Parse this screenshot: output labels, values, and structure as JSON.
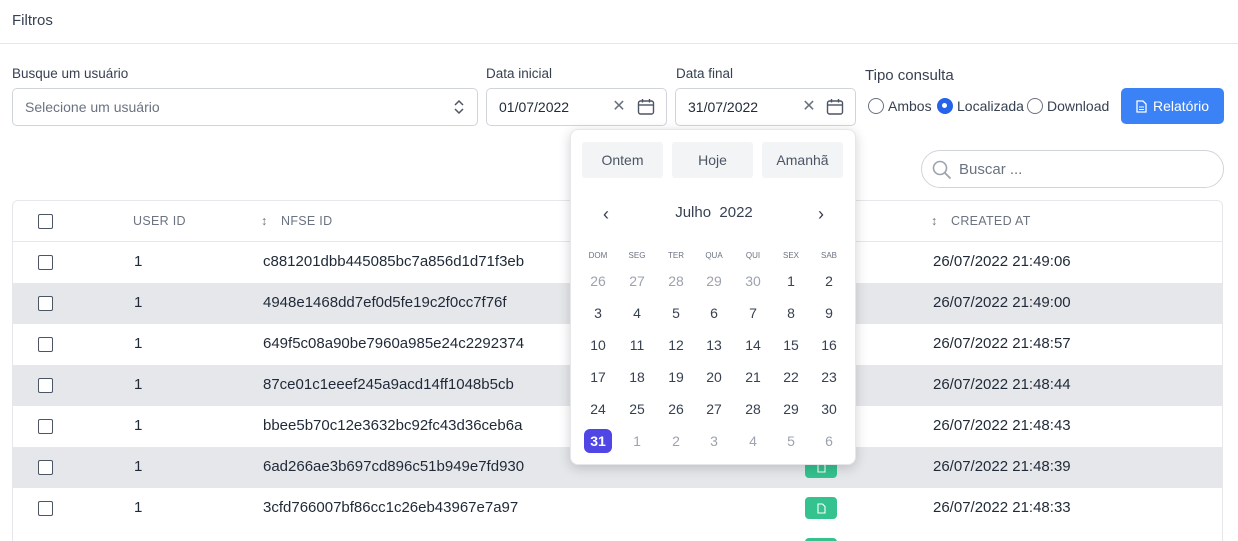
{
  "header": {
    "title": "Filtros"
  },
  "filters": {
    "user_label": "Busque um usuário",
    "user_placeholder": "Selecione um usuário",
    "start_label": "Data inicial",
    "start_value": "01/07/2022",
    "end_label": "Data final",
    "end_value": "31/07/2022",
    "type_label": "Tipo consulta",
    "types": [
      {
        "label": "Ambos",
        "checked": false
      },
      {
        "label": "Localizada",
        "checked": true
      },
      {
        "label": "Download",
        "checked": false
      }
    ],
    "report_button": "Relatório"
  },
  "search": {
    "placeholder": "Buscar ..."
  },
  "table": {
    "columns": [
      "USER ID",
      "NFSE ID",
      "CREATED AT"
    ],
    "rows": [
      {
        "user_id": "1",
        "nfse_id": "c881201dbb445085bc7a856d1d71f3eb",
        "created_at": "26/07/2022 21:49:06"
      },
      {
        "user_id": "1",
        "nfse_id": "4948e1468dd7ef0d5fe19c2f0cc7f76f",
        "created_at": "26/07/2022 21:49:00"
      },
      {
        "user_id": "1",
        "nfse_id": "649f5c08a90be7960a985e24c2292374",
        "created_at": "26/07/2022 21:48:57"
      },
      {
        "user_id": "1",
        "nfse_id": "87ce01c1eeef245a9acd14ff1048b5cb",
        "created_at": "26/07/2022 21:48:44"
      },
      {
        "user_id": "1",
        "nfse_id": "bbee5b70c12e3632bc92fc43d36ceb6a",
        "created_at": "26/07/2022 21:48:43"
      },
      {
        "user_id": "1",
        "nfse_id": "6ad266ae3b697cd896c51b949e7fd930",
        "created_at": "26/07/2022 21:48:39"
      },
      {
        "user_id": "1",
        "nfse_id": "3cfd766007bf86cc1c26eb43967e7a97",
        "created_at": "26/07/2022 21:48:33"
      }
    ]
  },
  "datepicker": {
    "quick": [
      "Ontem",
      "Hoje",
      "Amanhã"
    ],
    "month": "Julho",
    "year": "2022",
    "weekdays": [
      "DOM",
      "SEG",
      "TER",
      "QUA",
      "QUI",
      "SEX",
      "SAB"
    ],
    "weeks": [
      [
        "26",
        "27",
        "28",
        "29",
        "30",
        "1",
        "2"
      ],
      [
        "3",
        "4",
        "5",
        "6",
        "7",
        "8",
        "9"
      ],
      [
        "10",
        "11",
        "12",
        "13",
        "14",
        "15",
        "16"
      ],
      [
        "17",
        "18",
        "19",
        "20",
        "21",
        "22",
        "23"
      ],
      [
        "24",
        "25",
        "26",
        "27",
        "28",
        "29",
        "30"
      ],
      [
        "31",
        "1",
        "2",
        "3",
        "4",
        "5",
        "6"
      ]
    ],
    "selected_day": "31"
  },
  "colors": {
    "primary": "#3b82f6",
    "selected_day": "#4f46e5",
    "doc_button": "#34c38f"
  }
}
